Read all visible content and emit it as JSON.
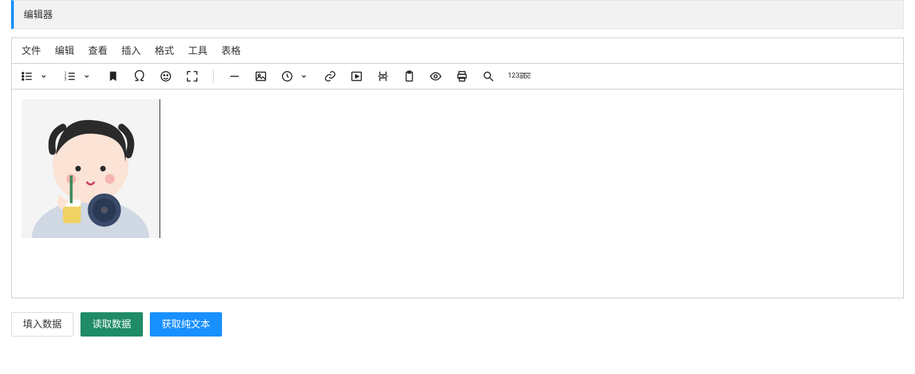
{
  "panel": {
    "title": "编辑器"
  },
  "menubar": {
    "items": [
      "文件",
      "编辑",
      "查看",
      "插入",
      "格式",
      "工具",
      "表格"
    ]
  },
  "toolbar": {
    "icons": [
      "bullet-list",
      "chevron-down",
      "numbered-list",
      "chevron-down",
      "bookmark",
      "omega",
      "emoji",
      "fullscreen",
      "separator",
      "horizontal-rule",
      "image",
      "clock",
      "chevron-down",
      "link",
      "video",
      "page-break",
      "paste",
      "preview",
      "print",
      "search",
      "find-replace"
    ],
    "find_replace_top": "123",
    "find_replace_bot": "abc"
  },
  "content": {
    "image_alt": "avatar illustration"
  },
  "buttons": {
    "fill": "填入数据",
    "read": "读取数据",
    "plain": "获取纯文本"
  }
}
